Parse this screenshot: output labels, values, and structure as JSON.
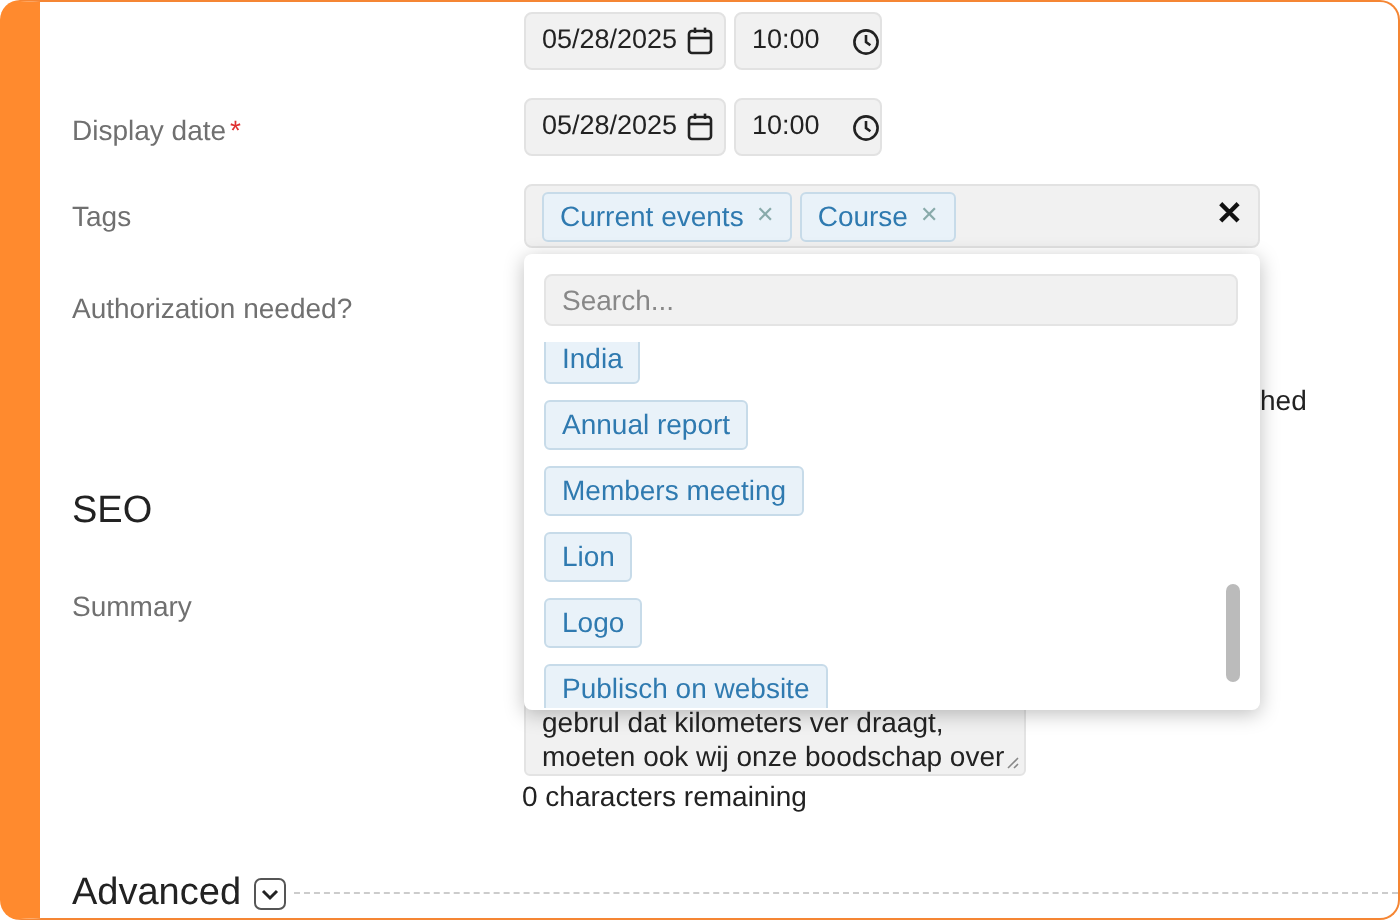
{
  "schedule": {
    "date": "05/28/2025",
    "time": "10:00"
  },
  "display_date": {
    "label": "Display date",
    "required": true,
    "required_mark": "*",
    "date": "05/28/2025",
    "time": "10:00"
  },
  "tags": {
    "label": "Tags",
    "selected": [
      "Current events",
      "Course"
    ],
    "remove_mark": "✕",
    "clear": "✕"
  },
  "authorization": {
    "label": "Authorization needed?",
    "partial_text": "hed"
  },
  "seo": {
    "heading": "SEO",
    "summary_label": "Summary",
    "summary_lines": [
      "gebrul dat kilometers ver draagt,",
      "moeten ook wij onze boodschap over"
    ],
    "counter": "0 characters remaining"
  },
  "advanced": {
    "heading": "Advanced",
    "expanded": false
  },
  "dropdown": {
    "placeholder": "Search...",
    "options": [
      "India",
      "Annual report",
      "Members meeting",
      "Lion",
      "Logo",
      "Publisch on website"
    ]
  }
}
